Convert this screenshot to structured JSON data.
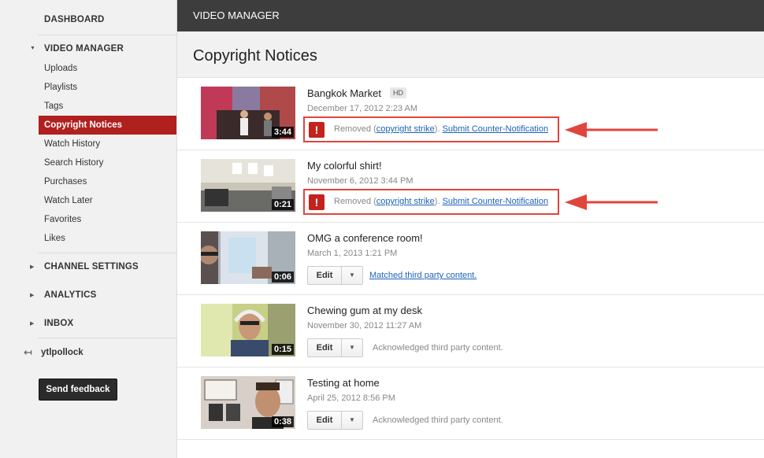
{
  "sidebar": {
    "dashboard": "DASHBOARD",
    "video_manager": "VIDEO MANAGER",
    "items": [
      "Uploads",
      "Playlists",
      "Tags",
      "Copyright Notices",
      "Watch History",
      "Search History",
      "Purchases",
      "Watch Later",
      "Favorites",
      "Likes"
    ],
    "active_item": "Copyright Notices",
    "channel_settings": "CHANNEL SETTINGS",
    "analytics": "ANALYTICS",
    "inbox": "INBOX",
    "username": "ytlpollock",
    "feedback_button": "Send feedback"
  },
  "topbar": {
    "title": "VIDEO MANAGER"
  },
  "page": {
    "title": "Copyright Notices"
  },
  "videos": [
    {
      "title": "Bangkok Market",
      "badge": "HD",
      "date": "December 17, 2012 2:23 AM",
      "duration": "3:44",
      "status": {
        "removed_prefix": "Removed (",
        "strike_link": "copyright strike",
        "removed_suffix": "). ",
        "counter_link": "Submit Counter-Notification"
      }
    },
    {
      "title": "My colorful shirt!",
      "date": "November 6, 2012 3:44 PM",
      "duration": "0:21",
      "status": {
        "removed_prefix": "Removed (",
        "strike_link": "copyright strike",
        "removed_suffix": "). ",
        "counter_link": "Submit Counter-Notification"
      }
    },
    {
      "title": "OMG a conference room!",
      "date": "March 1, 2013 1:21 PM",
      "duration": "0:06",
      "edit_label": "Edit",
      "status_link": "Matched third party content."
    },
    {
      "title": "Chewing gum at my desk",
      "date": "November 30, 2012 11:27 AM",
      "duration": "0:15",
      "edit_label": "Edit",
      "status_text": "Acknowledged third party content."
    },
    {
      "title": "Testing at home",
      "date": "April 25, 2012 8:56 PM",
      "duration": "0:38",
      "edit_label": "Edit",
      "status_text": "Acknowledged third party content."
    }
  ],
  "colors": {
    "accent": "#b0201f",
    "annotation": "#e0453c",
    "link": "#1c62b9",
    "topbar": "#3d3d3d"
  }
}
